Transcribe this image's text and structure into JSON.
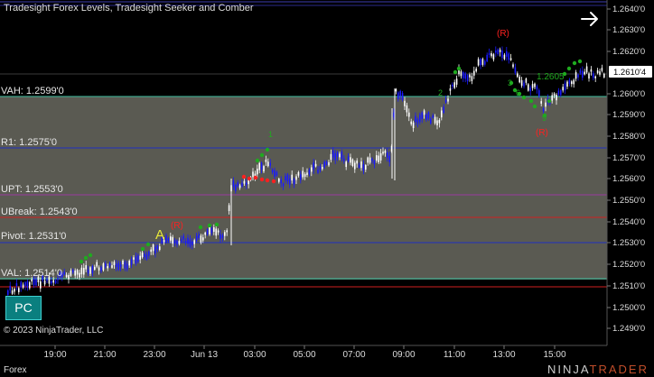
{
  "chart_title": "Tradesight Forex Levels, Tradesight Seeker and Comber",
  "colors": {
    "background": "#000000",
    "zone_fill": "#5a5a52",
    "up_candle": "#ffffff",
    "down_candle": "#1a1aff",
    "resistance_line": "#d02020",
    "support_line": "#2030c0",
    "vah_line": "#3fbf9f",
    "signal_green": "#1faa1f",
    "signal_red": "#ff2020",
    "accent_teal": "#0a7f7f"
  },
  "levels": {
    "vah": "VAH: 1.2599'0",
    "r1": "R1: 1.2575'0",
    "upt": "UPT: 1.2553'0",
    "ubreak": "UBreak: 1.2543'0",
    "pivot": "Pivot: 1.2531'0",
    "val": "VAL: 1.2514'0"
  },
  "price_axis": {
    "ticks": [
      "1.2640'0",
      "1.2630'0",
      "1.2620'0",
      "1.2610'4",
      "1.2600'0",
      "1.2590'0",
      "1.2580'0",
      "1.2570'0",
      "1.2560'0",
      "1.2550'0",
      "1.2540'0",
      "1.2530'0",
      "1.2520'0",
      "1.2510'0",
      "1.2500'0",
      "1.2490'0"
    ],
    "current_price": "1.2610'4"
  },
  "time_axis": [
    "19:00",
    "21:00",
    "23:00",
    "Jun 13",
    "03:00",
    "05:00",
    "07:00",
    "09:00",
    "11:00",
    "13:00",
    "15:00"
  ],
  "annotations": {
    "marker_a": "A",
    "marker_r1": "(R)",
    "marker_r2": "(R)",
    "marker_r3": "(R)",
    "price_note": "1.2605",
    "seq_1": "1",
    "seq_2": "2",
    "seq_3": "3",
    "seq_6": "6",
    "seq_9": "9"
  },
  "pc_button": "PC",
  "copyright": "© 2023 NinjaTrader, LLC",
  "instrument": "Forex",
  "brand": {
    "part1": "NINJA",
    "part2": "TRADER"
  }
}
